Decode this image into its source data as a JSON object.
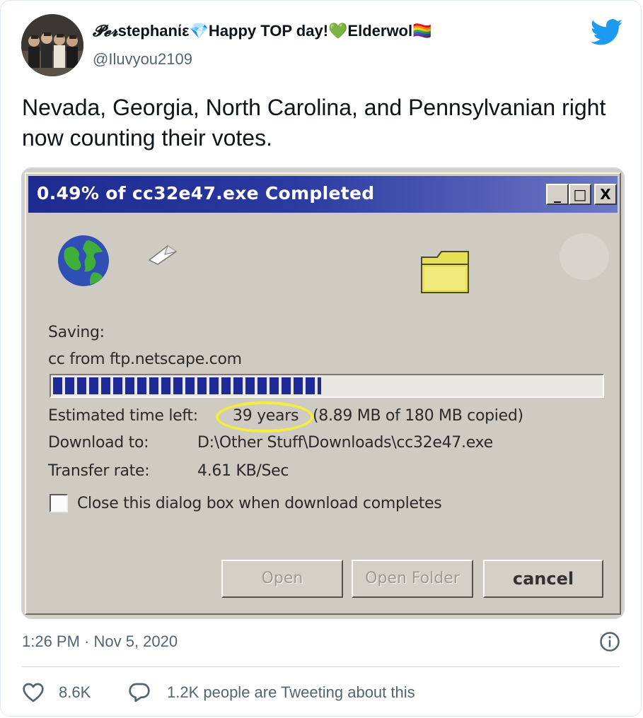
{
  "tweet": {
    "author": {
      "name_script": "𝓟𝓮𝓻",
      "name_rest": "stephanίε💎Happy TOP day!💚Elderwol🏳️‍🌈",
      "handle": "@Iluvyou2109"
    },
    "text": "Nevada, Georgia, North Carolina, and Pennsylvanian right now counting their votes.",
    "timestamp": "1:26 PM · Nov 5, 2020",
    "likes": "8.6K",
    "replies": "1.2K people are Tweeting about this",
    "icons": {
      "brand": "twitter-bird-icon",
      "info": "info-icon",
      "like": "heart-icon",
      "reply": "speech-bubble-icon"
    },
    "colors": {
      "twitter_blue": "#1d9bf0",
      "secondary_text": "#536471"
    }
  },
  "dialog": {
    "title": "0.49% of cc32e47.exe Completed",
    "saving_label": "Saving:",
    "saving_value": "cc from ftp.netscape.com",
    "progress_fraction": 0.49,
    "est_label": "Estimated time left:",
    "est_value": "39 years",
    "est_copied": "(8.89 MB of 180 MB copied)",
    "download_label": "Download to:",
    "download_value": "D:\\Other Stuff\\Downloads\\cc32e47.exe",
    "rate_label": "Transfer rate:",
    "rate_value": "4.61 KB/Sec",
    "checkbox_label": "Close this dialog box when download completes",
    "buttons": {
      "open": "Open",
      "open_folder": "Open Folder",
      "cancel": "cancel"
    },
    "window_controls": {
      "minimize": "_",
      "maximize": "□",
      "close": "X"
    },
    "highlight_color": "#f2ee3b"
  }
}
